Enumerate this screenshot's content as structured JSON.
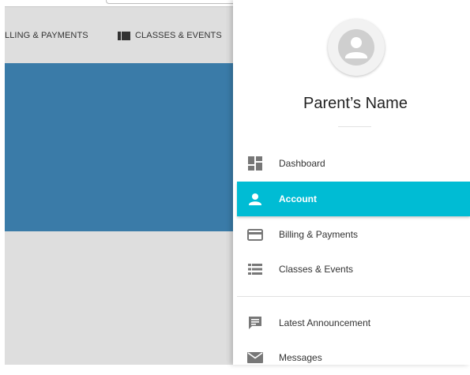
{
  "background": {
    "nav": {
      "billing_label": "LLING & PAYMENTS",
      "classes_label": "CLASSES & EVENTS"
    },
    "colors": {
      "hero": "#3a7ba8",
      "page": "#dedede"
    }
  },
  "drawer": {
    "user_name": "Parent’s Name",
    "menu": [
      {
        "label": "Dashboard",
        "icon": "dashboard-icon",
        "active": false
      },
      {
        "label": "Account",
        "icon": "person-icon",
        "active": true
      },
      {
        "label": "Billing & Payments",
        "icon": "credit-card-icon",
        "active": false
      },
      {
        "label": "Classes & Events",
        "icon": "list-icon",
        "active": false
      },
      {
        "label": "Latest Announcement",
        "icon": "announcement-icon",
        "active": false
      },
      {
        "label": "Messages",
        "icon": "mail-icon",
        "active": false
      }
    ],
    "colors": {
      "active": "#00bcd4",
      "icon": "#777777"
    }
  }
}
